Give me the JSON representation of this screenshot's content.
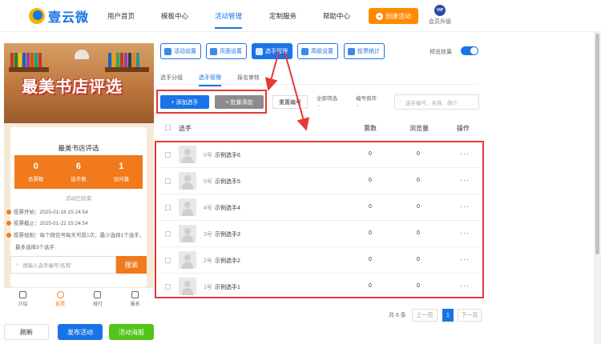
{
  "header": {
    "logo": "壹云微",
    "nav": [
      "用户首页",
      "模板中心",
      "活动管理",
      "定制服务",
      "帮助中心"
    ],
    "active_nav": "活动管理",
    "create_btn": "创建活动",
    "vip_badge": "VIP",
    "vip_label": "会员升级"
  },
  "preview": {
    "banner_title": "最美书店评选",
    "card_title": "最美书店评选",
    "stats": [
      {
        "num": "0",
        "label": "总票数"
      },
      {
        "num": "6",
        "label": "选手数"
      },
      {
        "num": "1",
        "label": "访问量"
      }
    ],
    "ended": "活动已结束",
    "start": "投票开始：2025-01-16 15:24:54",
    "end": "投票截止：2025-01-22 15:24:54",
    "rule": "投票规则：每个微信号每天可投1次，最少选择1个选手，",
    "rule2": "最多选择3个选手",
    "search_placeholder": "请输入选手编号/名称",
    "search_btn": "搜索",
    "tabs": [
      "介绍",
      "投票",
      "排行",
      "报名"
    ],
    "active_tab": "投票"
  },
  "actions": {
    "refresh": "刷新",
    "publish": "发布活动",
    "poster": "活动海报"
  },
  "toolbar": {
    "buttons": [
      "活动设置",
      "页面设置",
      "选手管理",
      "高级设置",
      "投票统计"
    ],
    "active": "选手管理",
    "preview_label": "预览效果"
  },
  "subtabs": [
    "选手分组",
    "选手管理",
    "报名审核"
  ],
  "active_subtab": "选手管理",
  "controls": {
    "add": "+ 添加选手",
    "batch": "+ 批量添加",
    "reset": "重置编号",
    "filter_all": "全部筛选",
    "filter_order": "编号倒序",
    "search_placeholder": "选手编号、名称、简介"
  },
  "table": {
    "headers": {
      "player": "选手",
      "votes": "票数",
      "views": "浏览量",
      "ops": "操作"
    },
    "rows": [
      {
        "num": "6号",
        "name": "示例选手6",
        "votes": "0",
        "views": "0",
        "ops": "···"
      },
      {
        "num": "5号",
        "name": "示例选手5",
        "votes": "0",
        "views": "0",
        "ops": "···"
      },
      {
        "num": "4号",
        "name": "示例选手4",
        "votes": "0",
        "views": "0",
        "ops": "···"
      },
      {
        "num": "3号",
        "name": "示例选手3",
        "votes": "0",
        "views": "0",
        "ops": "···"
      },
      {
        "num": "2号",
        "name": "示例选手2",
        "votes": "0",
        "views": "0",
        "ops": "···"
      },
      {
        "num": "1号",
        "name": "示例选手1",
        "votes": "0",
        "views": "0",
        "ops": "···"
      }
    ]
  },
  "pagination": {
    "total": "共 6 条",
    "prev": "上一页",
    "current": "1",
    "next": "下一页"
  },
  "colors": {
    "primary": "#1a73e8",
    "orange": "#ff8a00",
    "red": "#e53935",
    "green": "#52c41a"
  }
}
